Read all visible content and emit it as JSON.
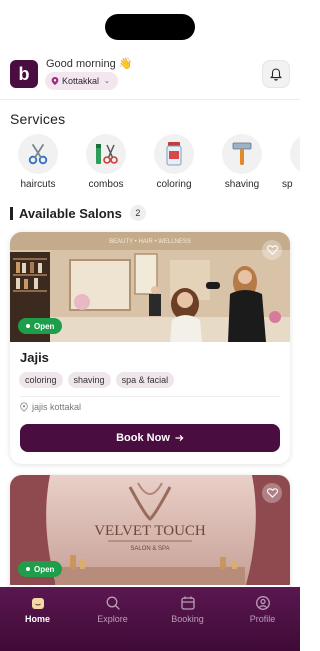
{
  "header": {
    "logo_letter": "b",
    "greeting": "Good morning 👋",
    "location": "Kottakkal"
  },
  "services": {
    "title": "Services",
    "items": [
      {
        "label": "haircuts",
        "icon": "scissors-icon"
      },
      {
        "label": "combos",
        "icon": "combo-tools-icon"
      },
      {
        "label": "coloring",
        "icon": "hair-dye-icon"
      },
      {
        "label": "shaving",
        "icon": "razor-icon"
      },
      {
        "label": "sp",
        "icon": "spa-icon"
      }
    ]
  },
  "salons": {
    "title": "Available Salons",
    "count": "2",
    "cards": [
      {
        "name": "Jajis",
        "status": "Open",
        "tags": [
          "coloring",
          "shaving",
          "spa & facial"
        ],
        "address": "jajis kottakal",
        "book_label": "Book Now",
        "sign_text": "BEAUTY • HAIR • WELLNESS"
      },
      {
        "status": "Open",
        "brand_title": "VELVET TOUCH",
        "brand_sub": "SALON & SPA"
      }
    ]
  },
  "nav": {
    "items": [
      {
        "label": "Home",
        "icon": "home-icon",
        "active": true
      },
      {
        "label": "Explore",
        "icon": "search-icon"
      },
      {
        "label": "Booking",
        "icon": "calendar-icon"
      },
      {
        "label": "Profile",
        "icon": "profile-icon"
      }
    ]
  },
  "colors": {
    "brand": "#4a0d3f",
    "open_badge": "#1e9e4b",
    "nav_bg": "#4f1146"
  }
}
